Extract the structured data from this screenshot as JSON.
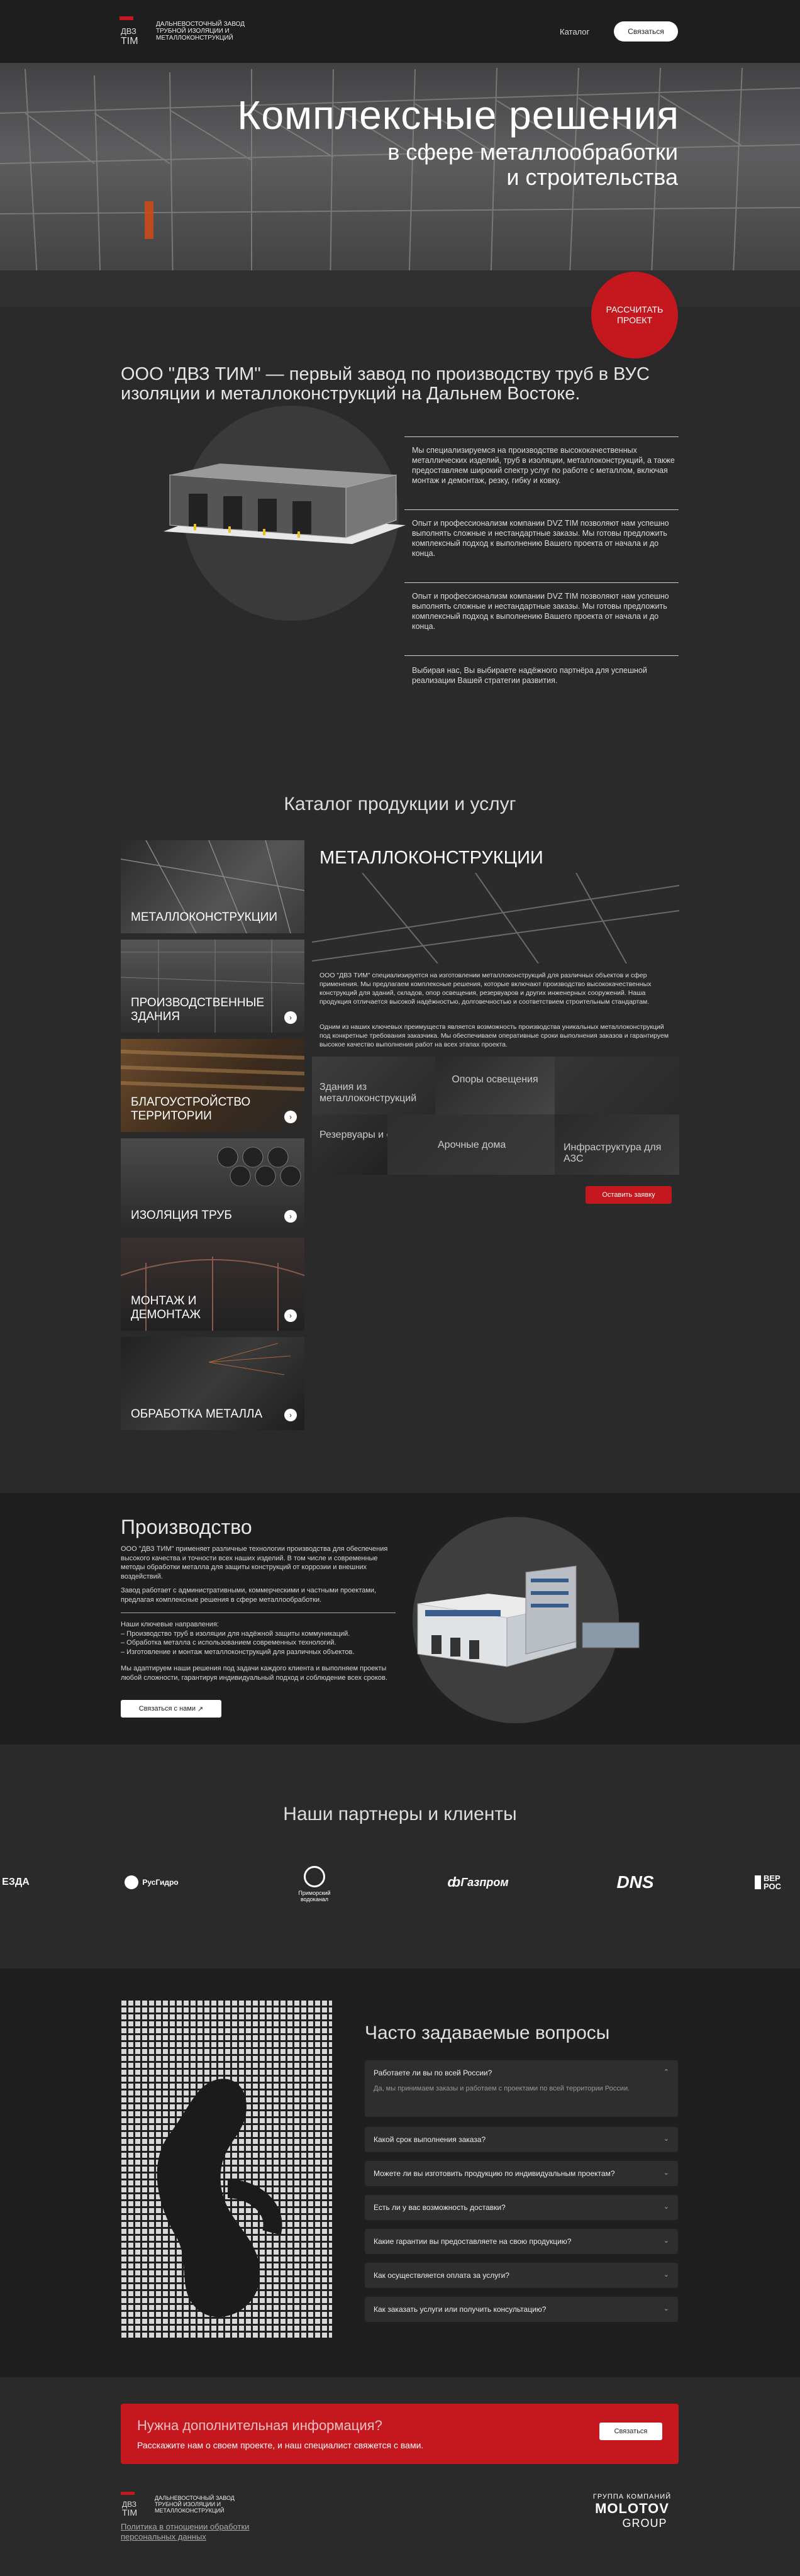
{
  "header": {
    "logo_lines": "ДАЛЬНЕВОСТОЧНЫЙ ЗАВОД ТРУБНОЙ ИЗОЛЯЦИИ И МЕТАЛЛОКОНСТРУКЦИЙ",
    "nav_catalog": "Каталог",
    "contact_button": "Связаться"
  },
  "hero": {
    "title": "Комплексные решения",
    "subtitle_1": "в сфере металлообработки",
    "subtitle_2": "и строительства",
    "calc_button": "Рассчитать проект"
  },
  "about": {
    "title": "ООО \"ДВЗ ТИМ\" — первый завод по производству труб в ВУС изоляции и металлоконструкций на Дальнем Востоке.",
    "p1": "Мы специализируемся на производстве высококачественных металлических изделий, труб в изоляции, металлоконструкций, а также предоставляем широкий спектр услуг по работе с металлом, включая монтаж и демонтаж, резку, гибку и ковку.",
    "p2": "Опыт и профессионализм компании DVZ TIM позволяют нам успешно выполнять сложные и нестандартные заказы. Мы готовы предложить комплексный подход к выполнению Вашего проекта от начала и до конца.",
    "p3": "Опыт и профессионализм компании DVZ TIM позволяют нам успешно выполнять сложные и нестандартные заказы. Мы готовы предложить комплексный подход к выполнению Вашего проекта от начала и до конца.",
    "p4": "Выбирая нас, Вы выбираете надёжного партнёра для успешной реализации Вашей стратегии развития."
  },
  "catalog": {
    "title": "Каталог продукции и услуг",
    "items": [
      {
        "label": "МЕТАЛЛОКОНСТРУКЦИИ"
      },
      {
        "label": "ПРОИЗВОДСТВЕННЫЕ ЗДАНИЯ"
      },
      {
        "label": "БЛАГОУСТРОЙСТВО ТЕРРИТОРИИ"
      },
      {
        "label": "ИЗОЛЯЦИЯ ТРУБ"
      },
      {
        "label": "МОНТАЖ И ДЕМОНТАЖ"
      },
      {
        "label": "ОБРАБОТКА МЕТАЛЛА"
      }
    ],
    "detail_title": "МЕТАЛЛОКОНСТРУКЦИИ",
    "detail_p1": "ООО \"ДВЗ ТИМ\" специализируется на изготовлении металлоконструкций для различных объектов и сфер применения. Мы предлагаем комплексные решения, которые включают производство высококачественных конструкций для зданий, складов, опор освещения, резервуаров и других инженерных сооружений. Наша продукция отличается высокой надёжностью, долговечностью и соответствием строительным стандартам.",
    "detail_p2": "Одним из наших ключевых преимуществ является возможность производства уникальных металлоконструкций под конкретные требования заказчика. Мы обеспечиваем оперативные сроки выполнения заказов и гарантируем высокое качество выполнения работ на всех этапах проекта.",
    "subtiles": [
      "Здания из металлоконструкций",
      "Опоры освещения",
      "Резервуары и ёмкости",
      "Арочные дома",
      "Инфраструктура для АЗС"
    ],
    "order_button": "Оставить заявку"
  },
  "production": {
    "title": "Производство",
    "p1": "ООО \"ДВЗ ТИМ\" применяет различные технологии производства для обеспечения высокого качества и точности всех наших изделий. В том числе и современные методы обработки металла для защиты конструкций от коррозии и внешних воздействий.",
    "p2": "Завод работает с административными, коммерческими и частными проектами, предлагая комплексные решения в сфере металлообработки.",
    "p3_head": "Наши ключевые направления:",
    "p3_l1": "– Производство труб в изоляции для надёжной защиты коммуникаций.",
    "p3_l2": "– Обработка металла с использованием современных технологий.",
    "p3_l3": "– Изготовление и монтаж металлоконструкций для различных объектов.",
    "p4": "Мы адаптируем наши решения под задачи каждого клиента и выполняем проекты любой сложности, гарантируя индивидуальный подход и соблюдение всех сроков.",
    "button": "Связаться с нами"
  },
  "partners": {
    "title": "Наши партнеры и клиенты",
    "items": [
      "ЕЗДА",
      "РусГидро",
      "Приморский водоканал",
      "Газпром",
      "DNS",
      "ВЕР РОС"
    ]
  },
  "faq": {
    "title": "Часто задаваемые вопросы",
    "items": [
      {
        "q": "Работаете ли вы по всей России?",
        "a": "Да, мы принимаем заказы и работаем с проектами по всей территории России."
      },
      {
        "q": "Какой срок выполнения заказа?"
      },
      {
        "q": "Можете ли вы изготовить продукцию по индивидуальным проектам?"
      },
      {
        "q": "Есть ли у вас возможность доставки?"
      },
      {
        "q": "Какие гарантии вы предоставляете на свою продукцию?"
      },
      {
        "q": "Как осуществляется оплата за услуги?"
      },
      {
        "q": "Как заказать услуги или получить консультацию?"
      }
    ]
  },
  "cta": {
    "title": "Нужна дополнительная информация?",
    "text": "Расскажите нам о своем проекте, и наш специалист свяжется с вами.",
    "button": "Связаться"
  },
  "footer": {
    "policy": "Политика в отношении обработки персональных данных",
    "group_1": "ГРУППА КОМПАНИЙ",
    "group_2": "MOLOTOV",
    "group_3": "GROUP"
  },
  "colors": {
    "accent": "#c4171e",
    "bg": "#2a2a2b",
    "dark": "#1f1f20"
  }
}
